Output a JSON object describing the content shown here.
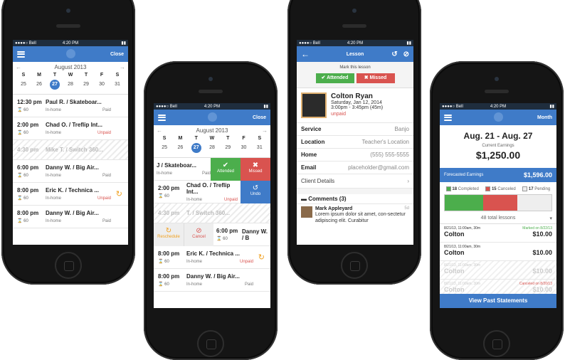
{
  "status": {
    "carrier": "●●●●○ Bell",
    "time": "4:20 PM"
  },
  "phone1": {
    "close": "Close",
    "month": "August 2013",
    "dow": [
      "S",
      "M",
      "T",
      "W",
      "T",
      "F",
      "S"
    ],
    "days": [
      "25",
      "26",
      "27",
      "28",
      "29",
      "30",
      "31"
    ],
    "rows": [
      {
        "time": "12:30 pm",
        "dur": "60",
        "name": "Paul R. / Skateboar...",
        "loc": "In-home",
        "pay": "Paid",
        "state": "paid"
      },
      {
        "time": "2:00 pm",
        "dur": "60",
        "name": "Chad O. / Treflip Int...",
        "loc": "In-home",
        "pay": "Unpaid",
        "state": "unpaid"
      },
      {
        "time": "4:30 pm",
        "dur": "",
        "name": "Mike T. / Switch 360...",
        "loc": "",
        "pay": "",
        "state": "hatch"
      },
      {
        "time": "6:00 pm",
        "dur": "60",
        "name": "Danny W. / Big Air...",
        "loc": "In-home",
        "pay": "Paid",
        "state": "paid"
      },
      {
        "time": "8:00 pm",
        "dur": "60",
        "name": "Eric K. / Technica ...",
        "loc": "In-home",
        "pay": "Unpaid",
        "state": "unpaid"
      },
      {
        "time": "8:00 pm",
        "dur": "60",
        "name": "Danny W. / Big Air...",
        "loc": "In-home",
        "pay": "Paid",
        "state": "paid"
      }
    ]
  },
  "phone2": {
    "close": "Close",
    "month": "August 2013",
    "dow": [
      "S",
      "M",
      "T",
      "W",
      "T",
      "F",
      "S"
    ],
    "days": [
      "25",
      "26",
      "27",
      "28",
      "29",
      "30",
      "31"
    ],
    "row1": {
      "name": "J / Skateboar...",
      "loc": "In-home",
      "pay": "Paid"
    },
    "attended": "Attended",
    "missed": "Missed",
    "undo": "Undo",
    "row2": {
      "time": "2:00 pm",
      "dur": "60",
      "name": "Chad O. / Treflip Int...",
      "loc": "In-home",
      "pay": "Unpaid"
    },
    "row3": {
      "time": "4:30 pm",
      "name": "T. / Switch 360..."
    },
    "reschedule": "Reschedule",
    "cancel": "Cancel",
    "row4": {
      "time": "6:00 pm",
      "dur": "60",
      "name": "Danny W. / B"
    },
    "row5": {
      "time": "8:00 pm",
      "dur": "60",
      "name": "Eric K. / Technica ...",
      "loc": "In-home",
      "pay": "Unpaid"
    },
    "row6": {
      "time": "8:00 pm",
      "dur": "60",
      "name": "Danny W. / Big Air...",
      "loc": "In-home",
      "pay": "Paid"
    }
  },
  "phone3": {
    "title": "Lesson",
    "mark": "Mark this lesson",
    "attended": "Attended",
    "missed": "Missed",
    "student": "Colton Ryan",
    "date": "Saturday, Jan 12, 2014",
    "time": "3:00pm - 3:45pm (45m)",
    "status": "unpaid",
    "fields": [
      {
        "k": "Service",
        "v": "Banjo"
      },
      {
        "k": "Location",
        "v": "Teacher's Location"
      },
      {
        "k": "Home",
        "v": "(555) 555-5555"
      },
      {
        "k": "Email",
        "v": "placeholder@gmail.com"
      }
    ],
    "details": "Client Details",
    "comments": "Comments (3)",
    "commenter": "Mark Appleyard",
    "ctime": "5d",
    "ctext": "Lorem ipsum dolor sit amet, con-sectetur adipiscing elit. Curabitur"
  },
  "phone4": {
    "month": "Month",
    "range": "Aug. 21 - Aug. 27",
    "cur_label": "Current Earnings",
    "cur_value": "$1,250.00",
    "fc_label": "Forecasted Earnings",
    "fc_value": "$1,596.00",
    "legend": [
      {
        "n": "18",
        "l": "Completed",
        "c": "#4cae4c"
      },
      {
        "n": "15",
        "l": "Canceled",
        "c": "#d9534f"
      },
      {
        "n": "17",
        "l": "Pending",
        "c": "#eeeeee"
      }
    ],
    "bar": [
      0.36,
      0.32,
      0.32
    ],
    "total": "48 total lessons",
    "lessons": [
      {
        "meta": "8/21/13, 11:00am, 30m",
        "flag": "Marked on 8/22/13",
        "name": "Colton",
        "amt": "$10.00",
        "state": "done"
      },
      {
        "meta": "8/21/13, 11:00am, 30m",
        "flag": "",
        "name": "Colton",
        "amt": "$10.00",
        "state": "done"
      },
      {
        "meta": "8/21/13, 11:00am, 30m",
        "flag": "",
        "name": "Colton",
        "amt": "$10.00",
        "state": "faded"
      },
      {
        "meta": "8/21/13, 11:00am, 30m",
        "flag": "Canceled on 8/20/13",
        "name": "Colton",
        "amt": "$10.00",
        "state": "canceled"
      },
      {
        "meta": "8/21/13, 11:00am, 30m",
        "flag": "",
        "name": "Colton",
        "amt": "",
        "state": "faded"
      }
    ],
    "footer": "View Past Statements"
  }
}
